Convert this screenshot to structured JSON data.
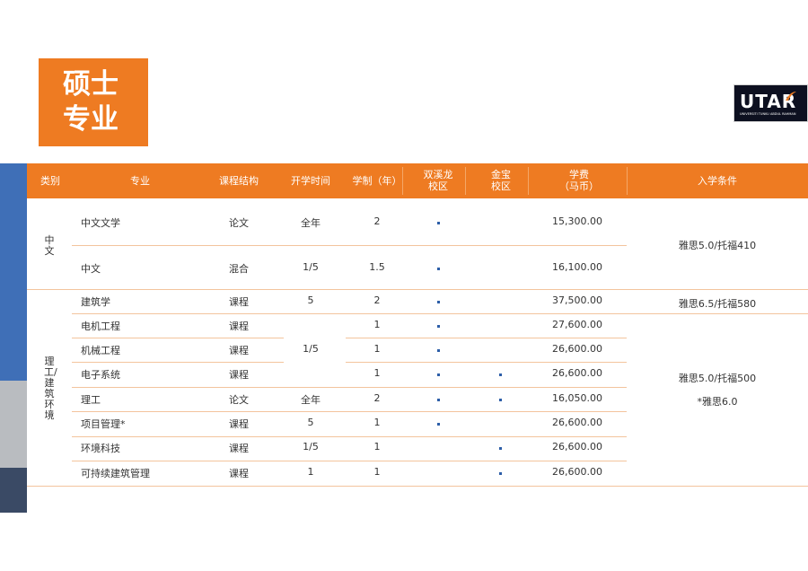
{
  "title": {
    "line1": "硕士",
    "line2": "专业"
  },
  "logo": {
    "text": "UTAR",
    "subtext": "UNIVERSITI TUNKU ABDUL RAHMAN",
    "brand_colors": [
      "#0d1020",
      "#ee7b22"
    ]
  },
  "colors": {
    "accent": "#ee7b22",
    "bar_blue": "#3f6fb7",
    "bar_gray": "#b9bcc0",
    "bar_navy": "#3a4a65",
    "dot": "#2d5ea8"
  },
  "headers": {
    "category": "类别",
    "major": "专业",
    "structure": "课程结构",
    "intake": "开学时间",
    "duration": "学制（年）",
    "campus1_l1": "双溪龙",
    "campus1_l2": "校区",
    "campus2_l1": "金宝",
    "campus2_l2": "校区",
    "fee_l1": "学费",
    "fee_l2": "（马币）",
    "requirement": "入学条件"
  },
  "groups": [
    {
      "name": "中文"
    },
    {
      "name": "理工/建筑环境"
    }
  ],
  "rows": [
    {
      "major": "中文文学",
      "structure": "论文",
      "intake": "全年",
      "duration": "2",
      "sungai_long": true,
      "kampar": false,
      "fee": "15,300.00"
    },
    {
      "major": "中文",
      "structure": "混合",
      "intake": "1/5",
      "duration": "1.5",
      "sungai_long": true,
      "kampar": false,
      "fee": "16,100.00"
    },
    {
      "major": "建筑学",
      "structure": "课程",
      "intake": "5",
      "duration": "2",
      "sungai_long": true,
      "kampar": false,
      "fee": "37,500.00"
    },
    {
      "major": "电机工程",
      "structure": "课程",
      "intake": "",
      "duration": "1",
      "sungai_long": true,
      "kampar": false,
      "fee": "27,600.00"
    },
    {
      "major": "机械工程",
      "structure": "课程",
      "intake": "1/5",
      "duration": "1",
      "sungai_long": true,
      "kampar": false,
      "fee": "26,600.00"
    },
    {
      "major": "电子系统",
      "structure": "课程",
      "intake": "",
      "duration": "1",
      "sungai_long": true,
      "kampar": true,
      "fee": "26,600.00"
    },
    {
      "major": "理工",
      "structure": "论文",
      "intake": "全年",
      "duration": "2",
      "sungai_long": true,
      "kampar": true,
      "fee": "16,050.00"
    },
    {
      "major": "项目管理*",
      "structure": "课程",
      "intake": "5",
      "duration": "1",
      "sungai_long": true,
      "kampar": false,
      "fee": "26,600.00"
    },
    {
      "major": "环境科技",
      "structure": "课程",
      "intake": "1/5",
      "duration": "1",
      "sungai_long": false,
      "kampar": true,
      "fee": "26,600.00"
    },
    {
      "major": "可持续建筑管理",
      "structure": "课程",
      "intake": "1",
      "duration": "1",
      "sungai_long": false,
      "kampar": true,
      "fee": "26,600.00"
    }
  ],
  "requirements": {
    "chinese": "雅思5.0/托福410",
    "architecture": "雅思6.5/托福580",
    "engineering_l1": "雅思5.0/托福500",
    "engineering_l2": "*雅思6.0"
  }
}
